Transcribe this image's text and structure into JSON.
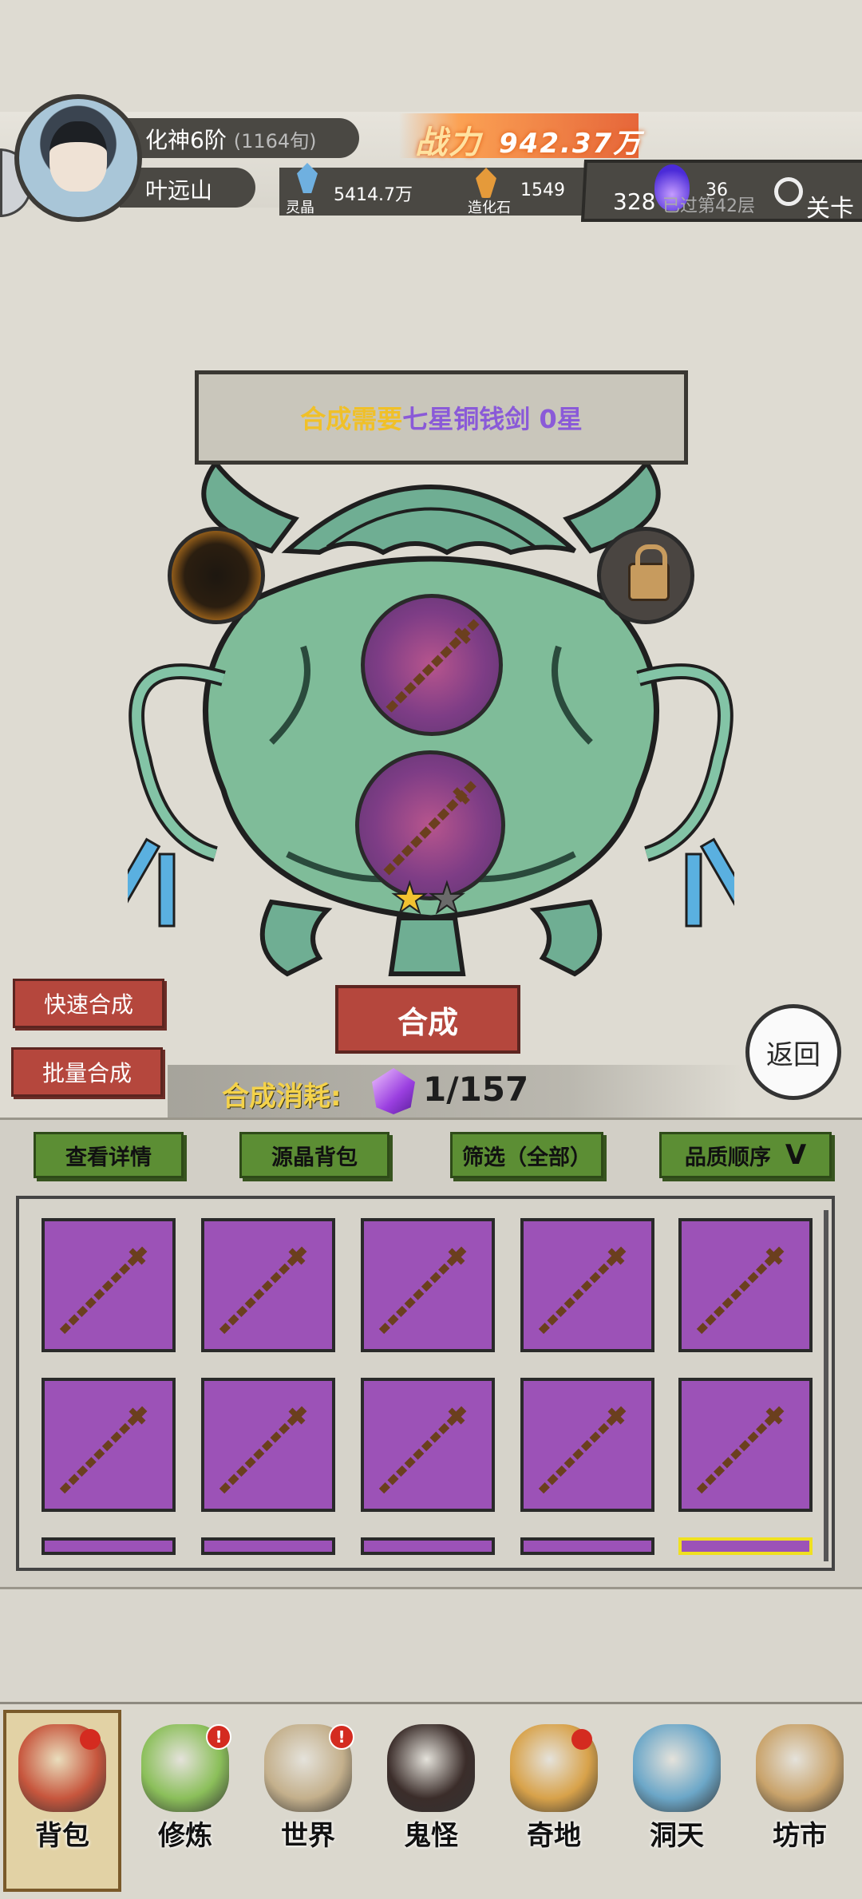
{
  "header": {
    "realm": "化神6阶",
    "realm_age": "(1164旬)",
    "player_name": "叶远山",
    "power_label": "战力",
    "power_value": "942.37万",
    "resources": [
      {
        "icon": "spirit-crystal-icon",
        "label": "灵晶",
        "value": "5414.7万",
        "color": "#6fb0e0"
      },
      {
        "icon": "creation-stone-icon",
        "label": "造化石",
        "value": "1549",
        "color": "#e59a3a"
      }
    ],
    "purple_currency": {
      "icon": "purple-flame-icon",
      "value": "36"
    },
    "stage": {
      "progress": "328",
      "text": "已过第42层",
      "button": "关卡"
    }
  },
  "synthesis": {
    "requirement_prefix": "合成需要",
    "requirement_item": "七星铜钱剑 0星",
    "button": "合成",
    "stars_filled": 1,
    "stars_total": 2,
    "quick_button": "快速合成",
    "batch_button": "批量合成",
    "back_button": "返回",
    "cost_label": "合成消耗:",
    "cost_value": "1/157"
  },
  "inventory": {
    "buttons": [
      "查看详情",
      "源晶背包",
      "筛选（全部）"
    ],
    "sort_button": "品质顺序",
    "sort_icon": "V",
    "item_name": "七星铜钱剑",
    "cell_color": "#9c52b7"
  },
  "nav": [
    {
      "label": "背包",
      "icon": "backpack-icon",
      "active": true,
      "alert": false,
      "dot": true
    },
    {
      "label": "修炼",
      "icon": "cultivation-icon",
      "active": false,
      "alert": true,
      "dot": false
    },
    {
      "label": "世界",
      "icon": "world-scroll-icon",
      "active": false,
      "alert": true,
      "dot": false
    },
    {
      "label": "鬼怪",
      "icon": "monster-egg-icon",
      "active": false,
      "alert": false,
      "dot": false
    },
    {
      "label": "奇地",
      "icon": "mystic-land-icon",
      "active": false,
      "alert": false,
      "dot": true
    },
    {
      "label": "洞天",
      "icon": "cave-heaven-icon",
      "active": false,
      "alert": false,
      "dot": false
    },
    {
      "label": "坊市",
      "icon": "market-icon",
      "active": false,
      "alert": false,
      "dot": false
    }
  ]
}
